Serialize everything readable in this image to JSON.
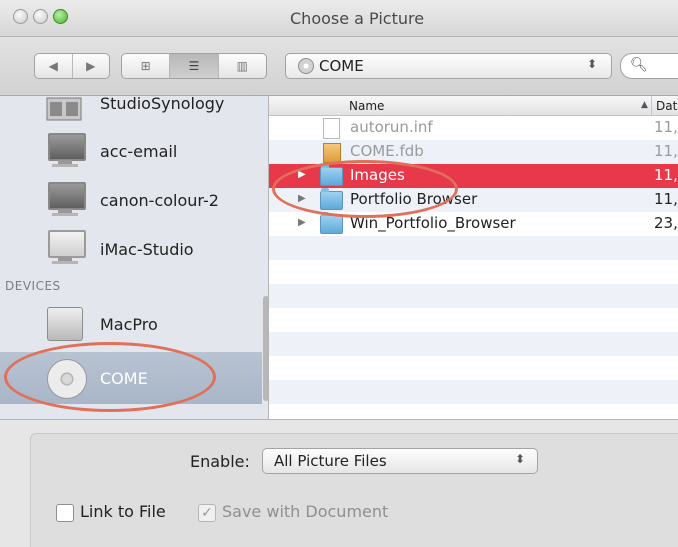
{
  "window": {
    "title": "Choose a Picture"
  },
  "toolbar": {
    "location": "COME",
    "search_placeholder": ""
  },
  "sidebar": {
    "items": [
      {
        "label": "StudioSynology",
        "icon": "server-icon"
      },
      {
        "label": "acc-email",
        "icon": "computer-icon"
      },
      {
        "label": "canon-colour-2",
        "icon": "computer-icon"
      },
      {
        "label": "iMac-Studio",
        "icon": "imac-icon"
      }
    ],
    "devices_header": "DEVICES",
    "devices": [
      {
        "label": "MacPro",
        "icon": "macpro-icon"
      },
      {
        "label": "COME",
        "icon": "cd-icon",
        "selected": true
      }
    ]
  },
  "file_list": {
    "columns": {
      "name": "Name",
      "date": "Dat"
    },
    "rows": [
      {
        "name": "autorun.inf",
        "date": "11,",
        "kind": "document",
        "dimmed": true
      },
      {
        "name": "COME.fdb",
        "date": "11,",
        "kind": "database",
        "dimmed": true
      },
      {
        "name": "Images",
        "date": "11,",
        "kind": "folder",
        "selected": true
      },
      {
        "name": "Portfolio Browser",
        "date": "11,",
        "kind": "folder"
      },
      {
        "name": "Win_Portfolio_Browser",
        "date": "23,",
        "kind": "folder"
      }
    ]
  },
  "options": {
    "enable_label": "Enable:",
    "enable_value": "All Picture Files",
    "link_to_file_label": "Link to File",
    "link_to_file_checked": false,
    "save_with_document_label": "Save with Document",
    "save_with_document_checked": true
  },
  "colors": {
    "selection_red": "#e8394a",
    "highlight_ring": "#e0705a",
    "sidebar_selection": "#b0bccd"
  }
}
